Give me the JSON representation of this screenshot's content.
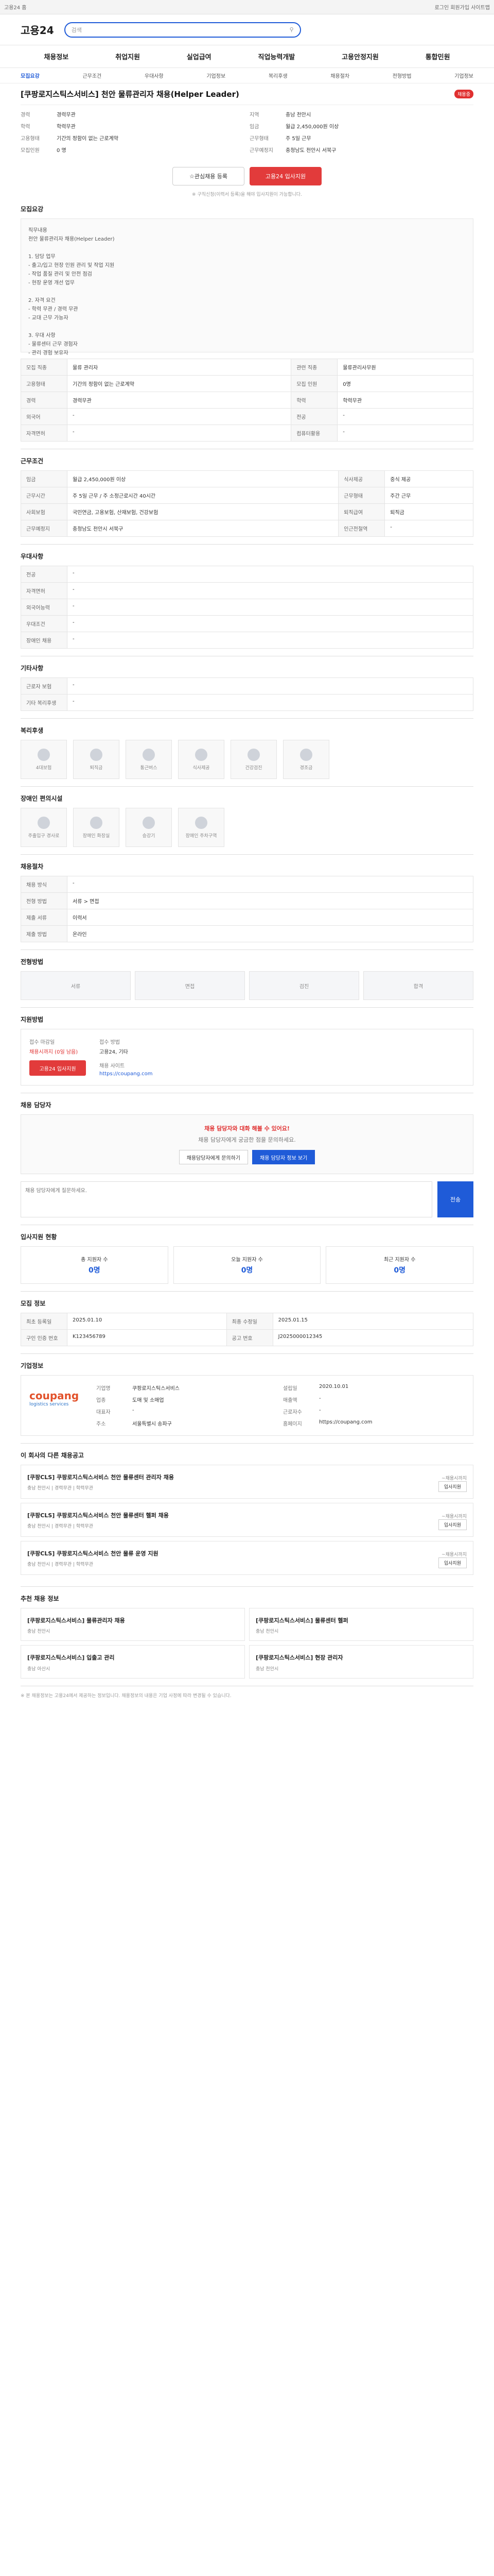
{
  "top": {
    "left": "고용24 홈",
    "right": "로그인 회원가입 사이트맵"
  },
  "header": {
    "logo": "고용24",
    "search_placeholder": "검색"
  },
  "gnb": [
    "채용정보",
    "취업지원",
    "실업급여",
    "직업능력개발",
    "고용안정지원",
    "통합민원"
  ],
  "subtabs": [
    "모집요강",
    "근무조건",
    "우대사항",
    "기업정보",
    "복리후생",
    "채용절차",
    "전형방법",
    "기업정보"
  ],
  "title": "[쿠팡로지스틱스서비스] 천안 물류관리자 채용(Helper Leader)",
  "badge": "채용중",
  "summary": [
    [
      "경력",
      "경력무관",
      "지역",
      "충남 천안시"
    ],
    [
      "학력",
      "학력무관",
      "임금",
      "월급 2,450,000원 이상"
    ],
    [
      "고용형태",
      "기간의 정함이 없는 근로계약",
      "근무형태",
      "주 5일 근무"
    ],
    [
      "모집인원",
      "0 명",
      "근무예정지",
      "충청남도 천안시 서북구"
    ]
  ],
  "actions": {
    "scrap": "관심채용 등록",
    "apply": "고용24 입사지원",
    "note": "※ 구직신청(이력서 등록)을 해야 입사지원이 가능합니다."
  },
  "detail": {
    "heading": "모집요강",
    "text": "직무내용\n천안 물류관리자 채용(Helper Leader)\n\n1. 담당 업무\n- 출고/입고 현장 인원 관리 및 작업 지원\n- 작업 품질 관리 및 안전 점검\n- 현장 운영 개선 업무\n\n2. 자격 요건\n- 학력 무관 / 경력 무관\n- 교대 근무 가능자\n\n3. 우대 사항\n- 물류센터 근무 경험자\n- 관리 경험 보유자"
  },
  "recruit_rows": [
    [
      "모집 직종",
      "물류 관리자",
      "관련 직종",
      "물류관리사무원"
    ],
    [
      "고용형태",
      "기간의 정함이 없는 근로계약",
      "모집 인원",
      "0명"
    ],
    [
      "경력",
      "경력무관",
      "학력",
      "학력무관"
    ],
    [
      "외국어",
      "-",
      "전공",
      "-"
    ],
    [
      "자격면허",
      "-",
      "컴퓨터활용",
      "-"
    ]
  ],
  "cond_heading": "근무조건",
  "cond_rows": [
    [
      "임금",
      "월급 2,450,000원 이상",
      "식사제공",
      "중식 제공"
    ],
    [
      "근무시간",
      "주 5일 근무 / 주 소정근로시간 40시간",
      "근무형태",
      "주간 근무"
    ],
    [
      "사회보험",
      "국민연금, 고용보험, 산재보험, 건강보험",
      "퇴직급여",
      "퇴직금"
    ],
    [
      "근무예정지",
      "충청남도 천안시 서북구",
      "인근전철역",
      "-"
    ]
  ],
  "pref_heading": "우대사항",
  "pref_rows": [
    [
      "전공",
      "-"
    ],
    [
      "자격면허",
      "-"
    ],
    [
      "외국어능력",
      "-"
    ],
    [
      "우대조건",
      "-"
    ],
    [
      "장애인 채용",
      "-"
    ]
  ],
  "extra_heading": "기타사항",
  "extra_rows": [
    [
      "근로자 보험",
      "-"
    ],
    [
      "기타 복리후생",
      "-"
    ]
  ],
  "welfare_heading": "복리후생",
  "welfare": [
    "4대보험",
    "퇴직금",
    "통근버스",
    "식사제공",
    "건강검진",
    "경조금"
  ],
  "barrier_heading": "장애인 편의시설",
  "barrier": [
    "주출입구 경사로",
    "장애인 화장실",
    "승강기",
    "장애인 주차구역"
  ],
  "proc_heading": "채용절차",
  "proc_rows": [
    [
      "채용 방식",
      "-"
    ],
    [
      "전형 방법",
      "서류 > 면접"
    ],
    [
      "제출 서류",
      "이력서"
    ],
    [
      "제출 방법",
      "온라인"
    ]
  ],
  "method_heading": "전형방법",
  "steps": [
    "서류",
    "면접",
    "검진",
    "합격"
  ],
  "apply_heading": "지원방법",
  "apply": {
    "a": "접수 마감일",
    "av": "채용시까지 (0일 남음)",
    "b": "접수 방법",
    "bv": "고용24, 기타",
    "c": "채용 사이트",
    "cv": "https://coupang.com",
    "btn": "고용24 입사지원"
  },
  "inq_heading": "채용 담당자",
  "inq": {
    "msg": "채용 담당자와 대화 해볼 수 있어요!",
    "sub": "채용 담당자에게 궁금한 점을 문의하세요.",
    "b1": "채용담당자에게 문의하기",
    "b2": "채용 담당자 정보 보기",
    "ph": "채용 담당자에게 질문하세요.",
    "send": "전송"
  },
  "stat_heading": "입사지원 현황",
  "stats": [
    [
      "총 지원자 수",
      "0명"
    ],
    [
      "오늘 지원자 수",
      "0명"
    ],
    [
      "최근 지원자 수",
      "0명"
    ]
  ],
  "info_heading": "모집 정보",
  "info_rows": [
    [
      "최초 등록일",
      "2025.01.10",
      "최종 수정일",
      "2025.01.15"
    ],
    [
      "구인 인증 번호",
      "K123456789",
      "공고 번호",
      "J2025000012345"
    ]
  ],
  "company_heading": "기업정보",
  "company": {
    "logo1": "coupang",
    "logo2": "logistics services",
    "rows": [
      [
        "기업명",
        "쿠팡로지스틱스서비스",
        "설립일",
        "2020.10.01"
      ],
      [
        "업종",
        "도매 및 소매업",
        "매출액",
        "-"
      ],
      [
        "대표자",
        "-",
        "근로자수",
        "-"
      ],
      [
        "주소",
        "서울특별시 송파구",
        "홈페이지",
        "https://coupang.com"
      ]
    ]
  },
  "related_heading": "이 회사의 다른 채용공고",
  "related": [
    [
      "[쿠팡CLS] 쿠팡로지스틱스서비스 천안 물류센터 관리자 채용",
      "충남 천안시 | 경력무관 | 학력무관",
      "~채용시까지"
    ],
    [
      "[쿠팡CLS] 쿠팡로지스틱스서비스 천안 물류센터 헬퍼 채용",
      "충남 천안시 | 경력무관 | 학력무관",
      "~채용시까지"
    ],
    [
      "[쿠팡CLS] 쿠팡로지스틱스서비스 천안 물류 운영 지원",
      "충남 천안시 | 경력무관 | 학력무관",
      "~채용시까지"
    ]
  ],
  "rec_heading": "추천 채용 정보",
  "rec": [
    [
      "[쿠팡로지스틱스서비스] 물류관리자 채용",
      "충남 천안시"
    ],
    [
      "[쿠팡로지스틱스서비스] 물류센터 헬퍼",
      "충남 천안시"
    ],
    [
      "[쿠팡로지스틱스서비스] 입출고 관리",
      "충남 아산시"
    ],
    [
      "[쿠팡로지스틱스서비스] 현장 관리자",
      "충남 천안시"
    ]
  ],
  "notes": "※ 본 채용정보는 고용24에서 제공하는 정보입니다. 채용정보의 내용은 기업 사정에 따라 변경될 수 있습니다."
}
